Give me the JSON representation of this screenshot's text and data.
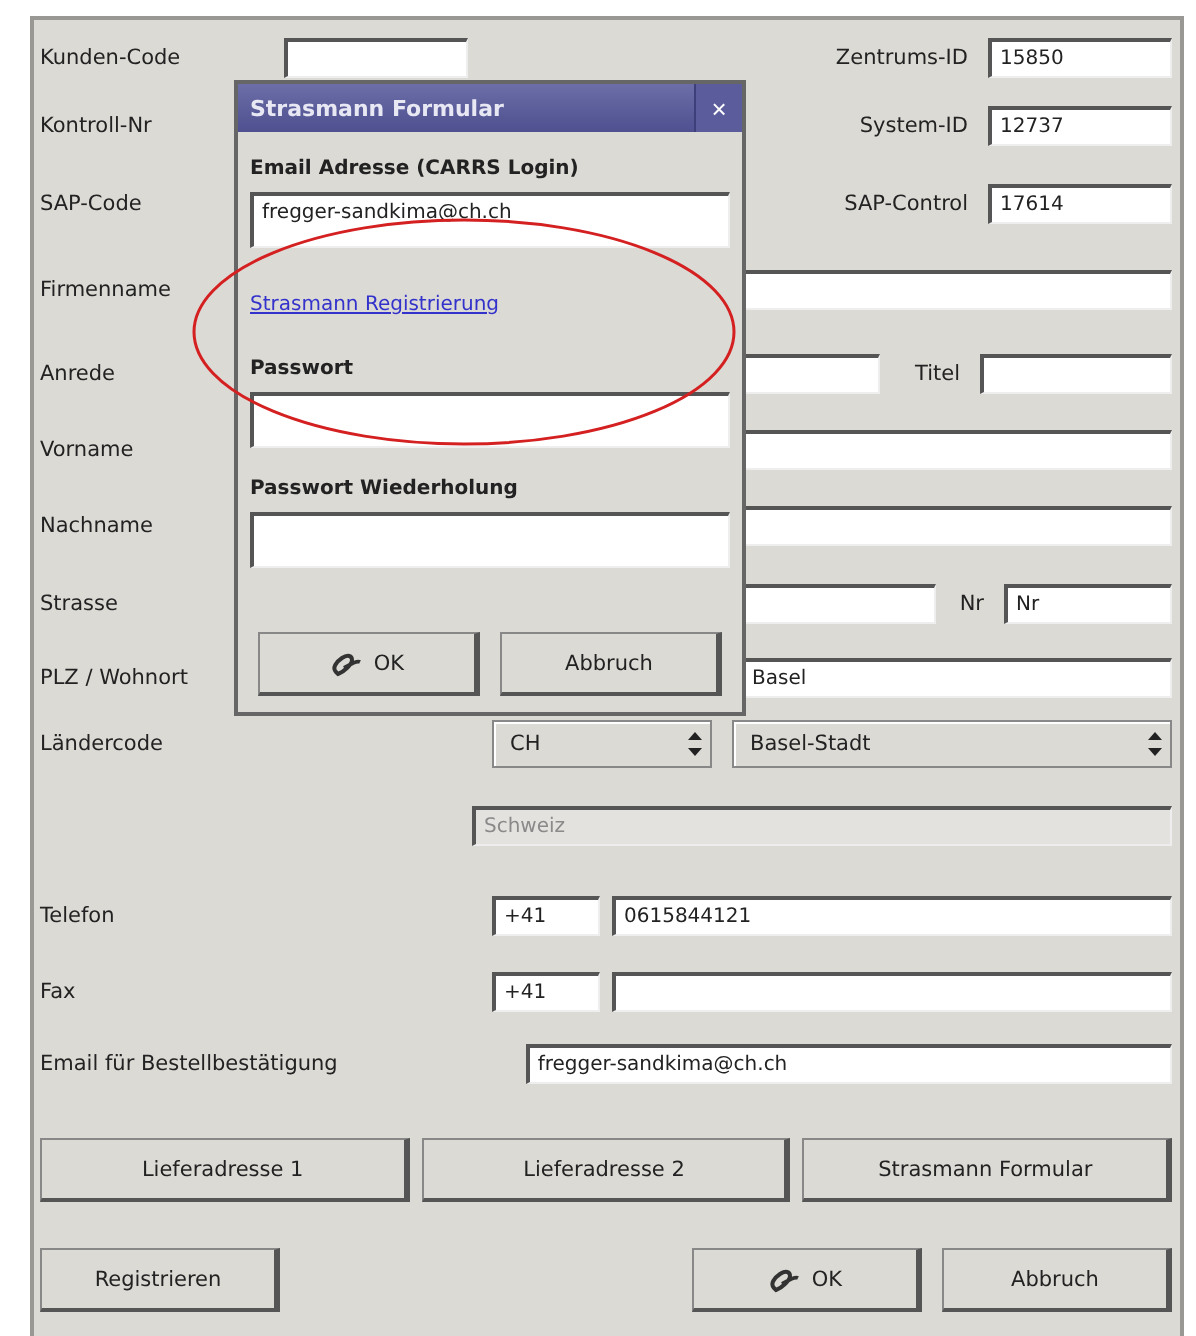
{
  "form": {
    "rows": [
      {
        "kind": "pair_field",
        "label": "Kunden-Code",
        "right_label": "Zentrums-ID",
        "right_value": "15850"
      },
      {
        "kind": "pair",
        "label": "Kontroll-Nr",
        "right_label": "System-ID",
        "right_value": "12737"
      },
      {
        "kind": "pair",
        "label": "SAP-Code",
        "right_label": "SAP-Control",
        "right_value": "17614"
      },
      {
        "kind": "text",
        "label": "Firmenname"
      },
      {
        "kind": "titel",
        "label": "Anrede",
        "right_label": "Titel"
      },
      {
        "kind": "text",
        "label": "Vorname"
      },
      {
        "kind": "text",
        "label": "Nachname"
      },
      {
        "kind": "street",
        "label": "Strasse",
        "right_label": "Nr",
        "right_value": "Nr"
      },
      {
        "kind": "town",
        "label": "PLZ / Wohnort",
        "value": "Basel"
      },
      {
        "kind": "selects",
        "label": "Ländercode",
        "value": "CH",
        "right_value": "Basel-Stadt"
      },
      {
        "kind": "disabled",
        "value": "Schweiz"
      },
      {
        "kind": "phone",
        "label": "Telefon",
        "value": "+41",
        "right_value": "0615844121"
      },
      {
        "kind": "phone",
        "label": "Fax",
        "value": "+41"
      },
      {
        "kind": "text",
        "label": "Email für Bestellbestätigung",
        "value": "fregger-sandkima@ch.ch"
      }
    ]
  },
  "middle_buttons": [
    "Lieferadresse 1",
    "Lieferadresse 2",
    "Strasmann Formular"
  ],
  "bottom_buttons": {
    "register": "Registrieren",
    "ok": "OK",
    "cancel": "Abbruch"
  },
  "dialog": {
    "title": "Strasmann Formular",
    "close": "×",
    "email_label": "Email Adresse (CARRS Login)",
    "email_value": "fregger-sandkima@ch.ch",
    "link": "Strasmann Registrierung",
    "password_label": "Passwort",
    "password_repeat_label": "Passwort Wiederholung",
    "ok": "OK",
    "cancel": "Abbruch"
  }
}
